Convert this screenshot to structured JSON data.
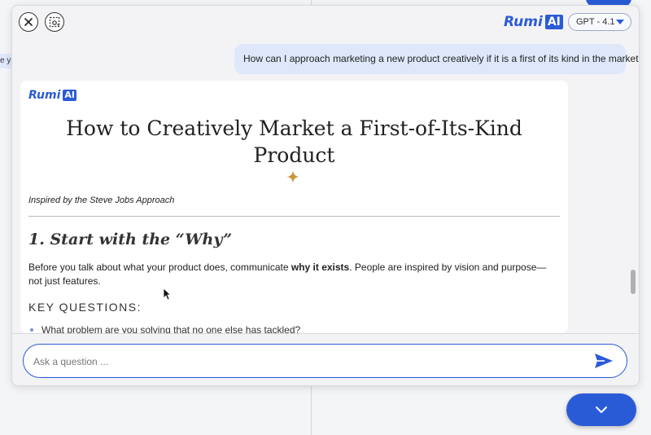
{
  "panel": {
    "logo": {
      "text": "Rumi",
      "badge": "AI"
    },
    "model_selector": {
      "selected": "GPT - 4.1"
    }
  },
  "background": {
    "edge_text": "e y"
  },
  "conversation": {
    "user_message": "How can I approach marketing a new product creatively if it is a first of its kind in the market",
    "answer": {
      "logo": {
        "text": "Rumi",
        "badge": "AI"
      },
      "title": "How to Creatively Market a First-of-Its-Kind Product",
      "inspired": "Inspired by the Steve Jobs Approach",
      "section_heading": "1. Start with the “Why”",
      "paragraph": {
        "before": "Before you talk about what your product does, communicate ",
        "bold": "why it exists",
        "after": ". People are inspired by vision and purpose—not just features."
      },
      "subheading": "KEY QUESTIONS:",
      "list": [
        "What problem are you solving that no one else has tackled?"
      ]
    }
  },
  "composer": {
    "placeholder": "Ask a question ..."
  },
  "colors": {
    "accent": "#2a5bd7",
    "user_bubble": "#dfe8fb",
    "sparkle": "#c9953d"
  },
  "icons": [
    "close-icon",
    "area-select-icon",
    "chevron-down-icon",
    "sparkle-icon",
    "send-icon",
    "mouse-cursor-icon"
  ]
}
